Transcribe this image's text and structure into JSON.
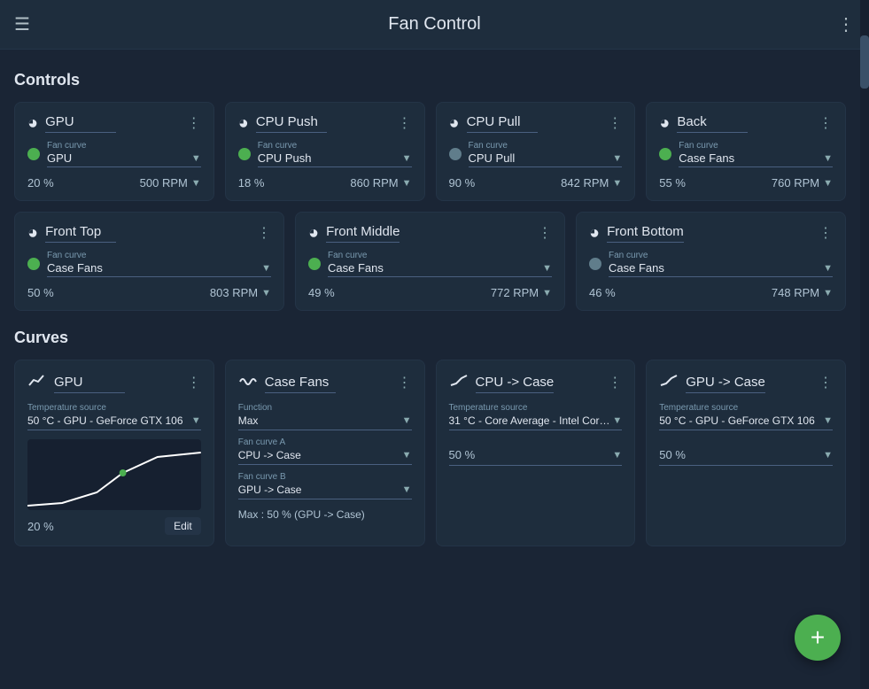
{
  "app": {
    "title": "Fan Control"
  },
  "sections": {
    "controls_title": "Controls",
    "curves_title": "Curves"
  },
  "controls": [
    {
      "name": "GPU",
      "fan_curve_label": "Fan curve",
      "fan_curve": "GPU",
      "percent": "20 %",
      "rpm": "500 RPM",
      "dot": "green"
    },
    {
      "name": "CPU Push",
      "fan_curve_label": "Fan curve",
      "fan_curve": "CPU Push",
      "percent": "18 %",
      "rpm": "860 RPM",
      "dot": "green"
    },
    {
      "name": "CPU Pull",
      "fan_curve_label": "Fan curve",
      "fan_curve": "CPU Pull",
      "percent": "90 %",
      "rpm": "842 RPM",
      "dot": "gray"
    },
    {
      "name": "Back",
      "fan_curve_label": "Fan curve",
      "fan_curve": "Case Fans",
      "percent": "55 %",
      "rpm": "760 RPM",
      "dot": "green"
    },
    {
      "name": "Front Top",
      "fan_curve_label": "Fan curve",
      "fan_curve": "Case Fans",
      "percent": "50 %",
      "rpm": "803 RPM",
      "dot": "green"
    },
    {
      "name": "Front Middle",
      "fan_curve_label": "Fan curve",
      "fan_curve": "Case Fans",
      "percent": "49 %",
      "rpm": "772 RPM",
      "dot": "green"
    },
    {
      "name": "Front Bottom",
      "fan_curve_label": "Fan curve",
      "fan_curve": "Case Fans",
      "percent": "46 %",
      "rpm": "748 RPM",
      "dot": "gray"
    }
  ],
  "curves": [
    {
      "id": "gpu",
      "name": "GPU",
      "type": "line",
      "temp_source_label": "Temperature source",
      "temp_source": "50 °C - GPU - GeForce GTX 106",
      "percent": "20 %",
      "has_chart": true
    },
    {
      "id": "case-fans",
      "name": "Case Fans",
      "type": "wave",
      "function_label": "Function",
      "function": "Max",
      "fan_curve_a_label": "Fan curve A",
      "fan_curve_a": "CPU -> Case",
      "fan_curve_b_label": "Fan curve B",
      "fan_curve_b": "GPU -> Case",
      "max_info": "Max : 50 % (GPU -> Case)"
    },
    {
      "id": "cpu-case",
      "name": "CPU -> Case",
      "type": "curve",
      "temp_source_label": "Temperature source",
      "temp_source": "31 °C - Core Average - Intel Cor…",
      "percent": "50 %"
    },
    {
      "id": "gpu-case",
      "name": "GPU -> Case",
      "type": "curve",
      "temp_source_label": "Temperature source",
      "temp_source": "50 °C - GPU - GeForce GTX 106",
      "percent": "50 %"
    }
  ],
  "fab": {
    "label": "+"
  }
}
